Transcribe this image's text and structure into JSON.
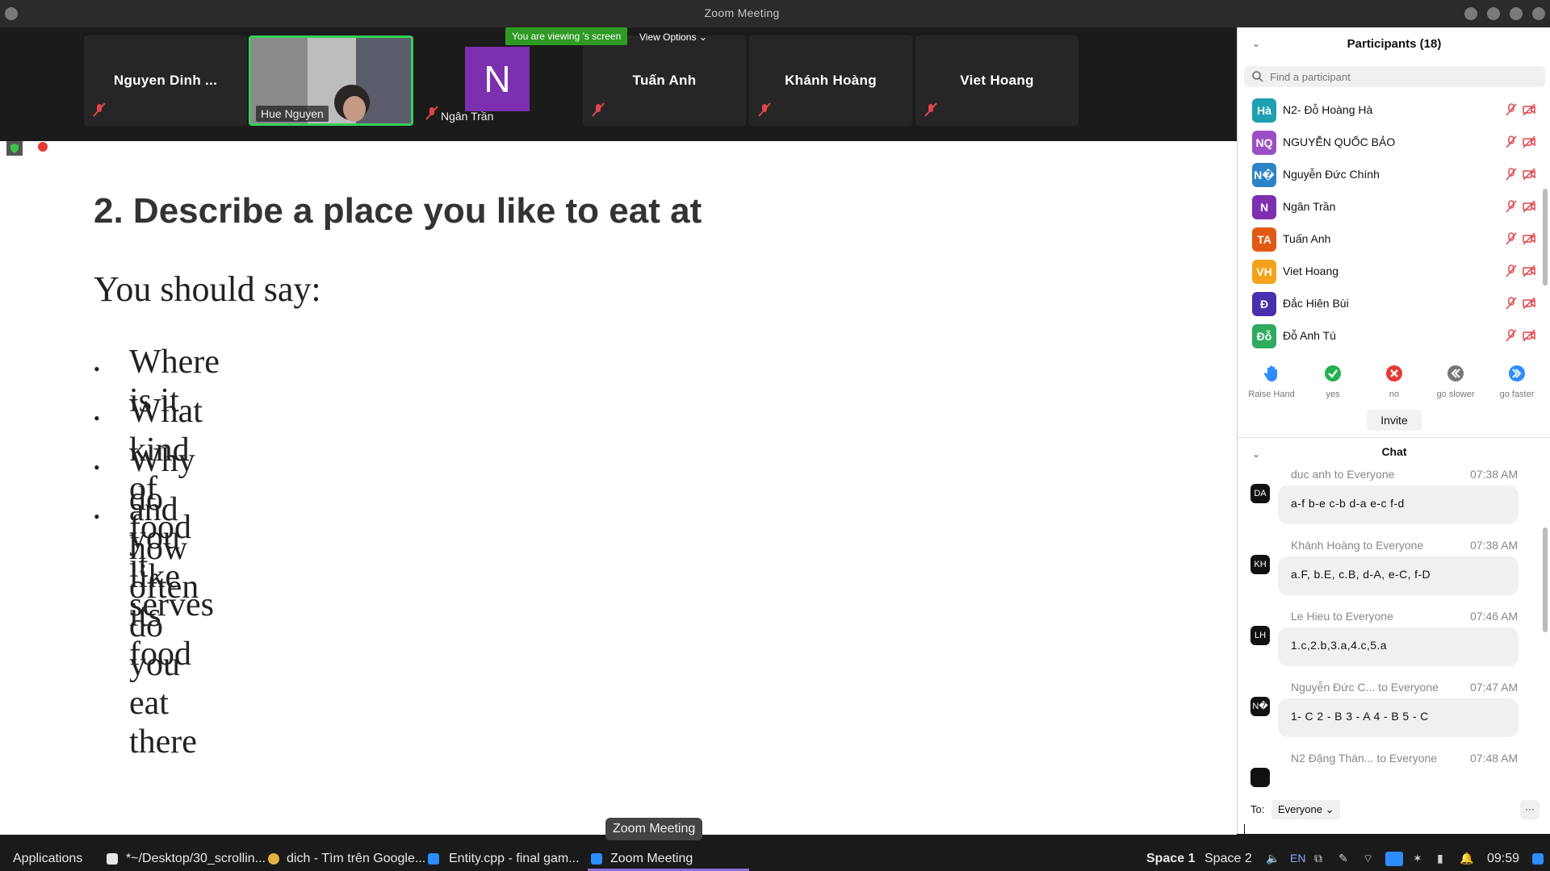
{
  "window": {
    "title": "Zoom Meeting"
  },
  "video_strip": {
    "tiles": [
      {
        "name": "Nguyen Dinh ..."
      },
      {
        "name": "Hue Nguyen"
      },
      {
        "name": "Ngân Trần",
        "avatar_letter": "N"
      },
      {
        "name": "Tuấn Anh"
      },
      {
        "name": "Khánh Hoàng"
      },
      {
        "name": "Viet Hoang"
      }
    ],
    "viewing_banner": "You are viewing 's screen",
    "view_options": "View Options"
  },
  "shared_screen": {
    "heading": "2. Describe a place you like to eat at",
    "intro": "You should say:",
    "bullets": [
      "Where is it",
      "What kind of food it serves",
      "Why do you like its food",
      "and how often do you eat there"
    ]
  },
  "participants": {
    "header": "Participants (18)",
    "search_placeholder": "Find a participant",
    "list": [
      {
        "initials": "Hà",
        "name": "N2- Đỗ Hoàng Hà",
        "color": "#1ea0b0"
      },
      {
        "initials": "NQ",
        "name": "NGUYỄN QUỐC BẢO",
        "color": "#9b4fc4"
      },
      {
        "initials": "N�",
        "name": "Nguyễn Đức Chính",
        "color": "#2a84c6"
      },
      {
        "initials": "N",
        "name": "Ngân Trần",
        "color": "#7c2fae"
      },
      {
        "initials": "TA",
        "name": "Tuấn Anh",
        "color": "#e05a12"
      },
      {
        "initials": "VH",
        "name": "Viet Hoang",
        "color": "#f2a31b"
      },
      {
        "initials": "Đ",
        "name": "Đắc Hiên Bùi",
        "color": "#4b2fae"
      },
      {
        "initials": "Đỗ",
        "name": "Đỗ Anh Tú",
        "color": "#2eab5e"
      }
    ],
    "reactions": [
      {
        "label": "Raise Hand",
        "icon": "raise-hand-icon",
        "color": "#2d8cff"
      },
      {
        "label": "yes",
        "icon": "yes-check-icon",
        "color": "#22b14c"
      },
      {
        "label": "no",
        "icon": "no-x-icon",
        "color": "#e53935"
      },
      {
        "label": "go slower",
        "icon": "go-slower-icon",
        "color": "#777777"
      },
      {
        "label": "go faster",
        "icon": "go-faster-icon",
        "color": "#2d8cff"
      }
    ],
    "invite_label": "Invite"
  },
  "chat": {
    "header": "Chat",
    "messages": [
      {
        "initials": "DA",
        "meta": "duc anh to Everyone",
        "time": "07:38 AM",
        "text": "a-f b-e c-b d-a e-c f-d"
      },
      {
        "initials": "KH",
        "meta": "Khánh Hoàng to Everyone",
        "time": "07:38 AM",
        "text": "a.F, b.E, c.B, d-A, e-C, f-D"
      },
      {
        "initials": "LH",
        "meta": "Le Hieu to Everyone",
        "time": "07:46 AM",
        "text": "1.c,2.b,3.a,4.c,5.a"
      },
      {
        "initials": "N�",
        "meta": "Nguyễn Đức C... to Everyone",
        "time": "07:47 AM",
        "text": "1- C 2 - B 3 - A 4 - B 5 - C"
      },
      {
        "initials": "",
        "meta": "N2 Đặng Thàn... to Everyone",
        "time": "07:48 AM",
        "text": ""
      }
    ],
    "to_label": "To:",
    "to_value": "Everyone",
    "more": "···"
  },
  "tooltip": "Zoom Meeting",
  "taskbar": {
    "applications": "Applications",
    "windows": [
      {
        "title": "*~/Desktop/30_scrollin...",
        "icon": "text-editor-icon"
      },
      {
        "title": "dich - Tìm trên Google...",
        "icon": "chrome-icon"
      },
      {
        "title": "Entity.cpp - final gam...",
        "icon": "vscode-icon"
      },
      {
        "title": "Zoom Meeting",
        "icon": "zoom-icon"
      }
    ],
    "workspaces": [
      "Space 1",
      "Space 2"
    ],
    "lang": "EN",
    "clock": "09:59"
  },
  "colors": {
    "zoom_blue": "#2d8cff",
    "active_green": "#34d058",
    "banner_green": "#2e9a24",
    "mute_red": "#e0454b"
  }
}
